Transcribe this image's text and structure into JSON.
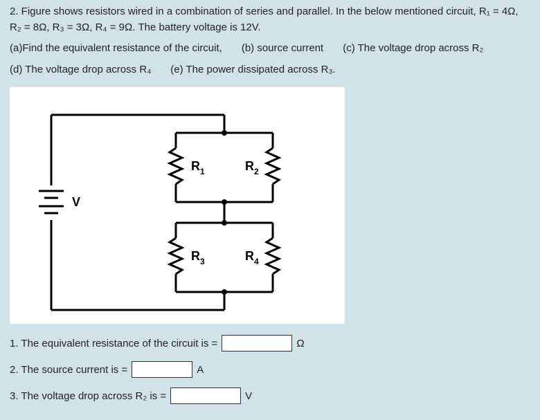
{
  "problem": {
    "intro_line1": "2. Figure shows resistors wired in a combination of series and parallel. In the below mentioned circuit, R₁ = 4Ω,",
    "intro_line2": "R₂ = 8Ω, R₃ = 3Ω, R₄ = 9Ω. The battery voltage is 12V.",
    "parts": {
      "a": "(a)Find the equivalent resistance of the circuit,",
      "b": "(b) source current",
      "c": "(c) The voltage drop across R₂",
      "d": "(d) The voltage drop across R₄",
      "e": "(e) The power dissipated across R₃."
    }
  },
  "circuit_labels": {
    "V": "V",
    "R1": "R",
    "R1sub": "1",
    "R2": "R",
    "R2sub": "2",
    "R3": "R",
    "R3sub": "3",
    "R4": "R",
    "R4sub": "4"
  },
  "answers": {
    "a1_label_before": "1. The equivalent resistance of the circuit is =",
    "a1_unit": "Ω",
    "a2_label_before": "2. The source current is  =",
    "a2_unit": "A",
    "a3_label_before": "3. The voltage drop across R₂ is =",
    "a3_unit": "V"
  }
}
